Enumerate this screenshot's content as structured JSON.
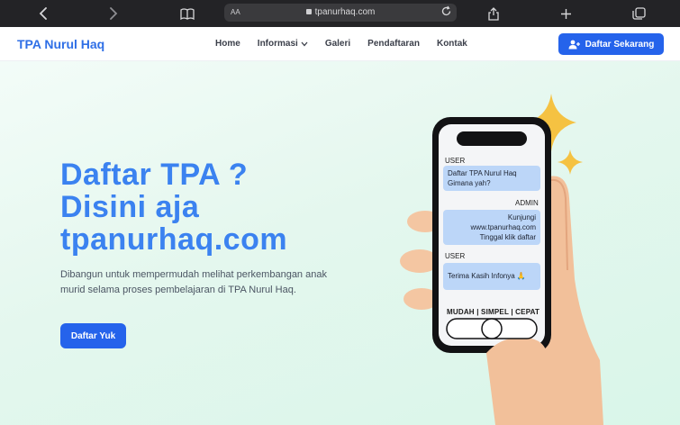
{
  "browser": {
    "url": "tpanurhaq.com",
    "text_size_label": "AA",
    "icons": [
      "back-icon",
      "forward-icon",
      "reader-icon",
      "lock-icon",
      "reload-icon",
      "share-icon",
      "new-tab-icon",
      "tabs-icon"
    ]
  },
  "navbar": {
    "brand": "TPA Nurul Haq",
    "links": [
      "Home",
      "Informasi",
      "Galeri",
      "Pendaftaran",
      "Kontak"
    ],
    "cta_label": "Daftar Sekarang"
  },
  "hero": {
    "headline_line1": "Daftar TPA ?",
    "headline_line2": "Disini aja",
    "headline_line3": "tpanurhaq.com",
    "description": "Dibangun untuk mempermudah melihat perkembangan anak murid selama proses pembelajaran di TPA Nurul Haq.",
    "button_label": "Daftar Yuk"
  },
  "phone_chat": {
    "user_label_1": "USER",
    "user_msg_1_line1": "Daftar TPA Nurul Haq",
    "user_msg_1_line2": "Gimana yah?",
    "admin_label": "ADMIN",
    "admin_msg_line1": "Kunjungi",
    "admin_msg_line2": "www.tpanurhaq.com",
    "admin_msg_line3": "Tinggal klik daftar",
    "user_label_2": "USER",
    "user_msg_2": "Terima Kasih Infonya 🙏",
    "tagline": "MUDAH | SIMPEL | CEPAT"
  },
  "colors": {
    "brand_blue": "#2f6fe6",
    "button_blue": "#2563eb",
    "headline_blue": "#3b82f0",
    "chat_bubble": "#bcd6f8",
    "sparkle": "#f5c242"
  }
}
